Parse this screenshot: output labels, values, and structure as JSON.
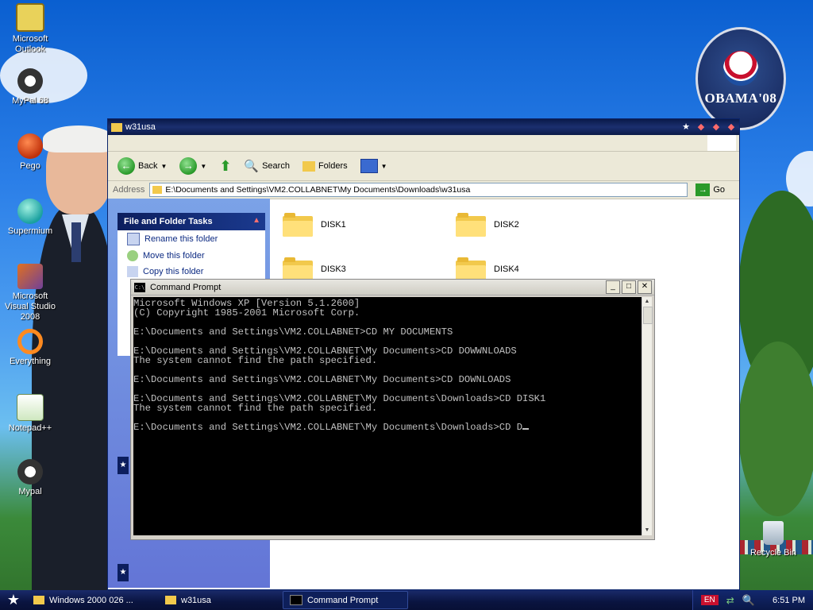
{
  "desktop_icons": [
    {
      "label": "Microsoft Outlook"
    },
    {
      "label": "MyPal 68"
    },
    {
      "label": "Pego"
    },
    {
      "label": "Supermium"
    },
    {
      "label": "Microsoft Visual Studio 2008"
    },
    {
      "label": "Everything"
    },
    {
      "label": "Notepad++"
    },
    {
      "label": "Mypal"
    }
  ],
  "wallpaper": {
    "badge_text": "OBAMA'08"
  },
  "recycle_bin": {
    "label": "Recycle Bin"
  },
  "explorer": {
    "title": "w31usa",
    "toolbar": {
      "back": "Back",
      "search": "Search",
      "folders": "Folders"
    },
    "address": {
      "label": "Address",
      "value": "E:\\Documents and Settings\\VM2.COLLABNET\\My Documents\\Downloads\\w31usa",
      "go": "Go"
    },
    "tasks": {
      "header": "File and Folder Tasks",
      "items": [
        "Rename this folder",
        "Move this folder",
        "Copy this folder"
      ]
    },
    "folders": [
      "DISK1",
      "DISK2",
      "DISK3",
      "DISK4"
    ]
  },
  "cmd": {
    "title": "Command Prompt",
    "lines": [
      "Microsoft Windows XP [Version 5.1.2600]",
      "(C) Copyright 1985-2001 Microsoft Corp.",
      "",
      "E:\\Documents and Settings\\VM2.COLLABNET>CD MY DOCUMENTS",
      "",
      "E:\\Documents and Settings\\VM2.COLLABNET\\My Documents>CD DOWWNLOADS",
      "The system cannot find the path specified.",
      "",
      "E:\\Documents and Settings\\VM2.COLLABNET\\My Documents>CD DOWNLOADS",
      "",
      "E:\\Documents and Settings\\VM2.COLLABNET\\My Documents\\Downloads>CD DISK1",
      "The system cannot find the path specified.",
      "",
      "E:\\Documents and Settings\\VM2.COLLABNET\\My Documents\\Downloads>CD D"
    ]
  },
  "taskbar": {
    "items": [
      "Windows 2000 026 ...",
      "w31usa",
      "Command Prompt"
    ],
    "lang": "EN",
    "time": "6:51 PM"
  }
}
